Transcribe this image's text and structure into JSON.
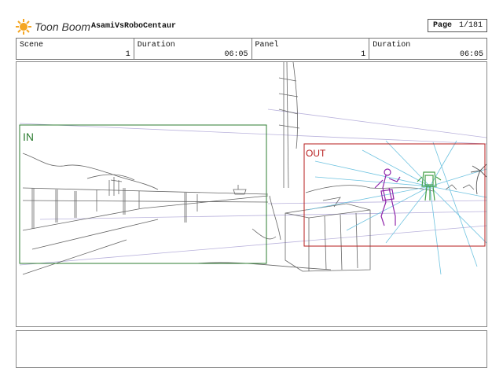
{
  "header": {
    "brand": "Toon Boom",
    "project_name": "AsamiVsRoboCentaur",
    "page_label": "Page",
    "page_value": "1/181"
  },
  "info": {
    "scene_label": "Scene",
    "scene_value": "1",
    "duration1_label": "Duration",
    "duration1_value": "06:05",
    "panel_label": "Panel",
    "panel_value": "1",
    "duration2_label": "Duration",
    "duration2_value": "06:05"
  },
  "panel": {
    "in_label": "IN",
    "out_label": "OUT",
    "in_color": "#2e7d32",
    "out_color": "#b71c1c"
  },
  "notes": {
    "text": ""
  }
}
